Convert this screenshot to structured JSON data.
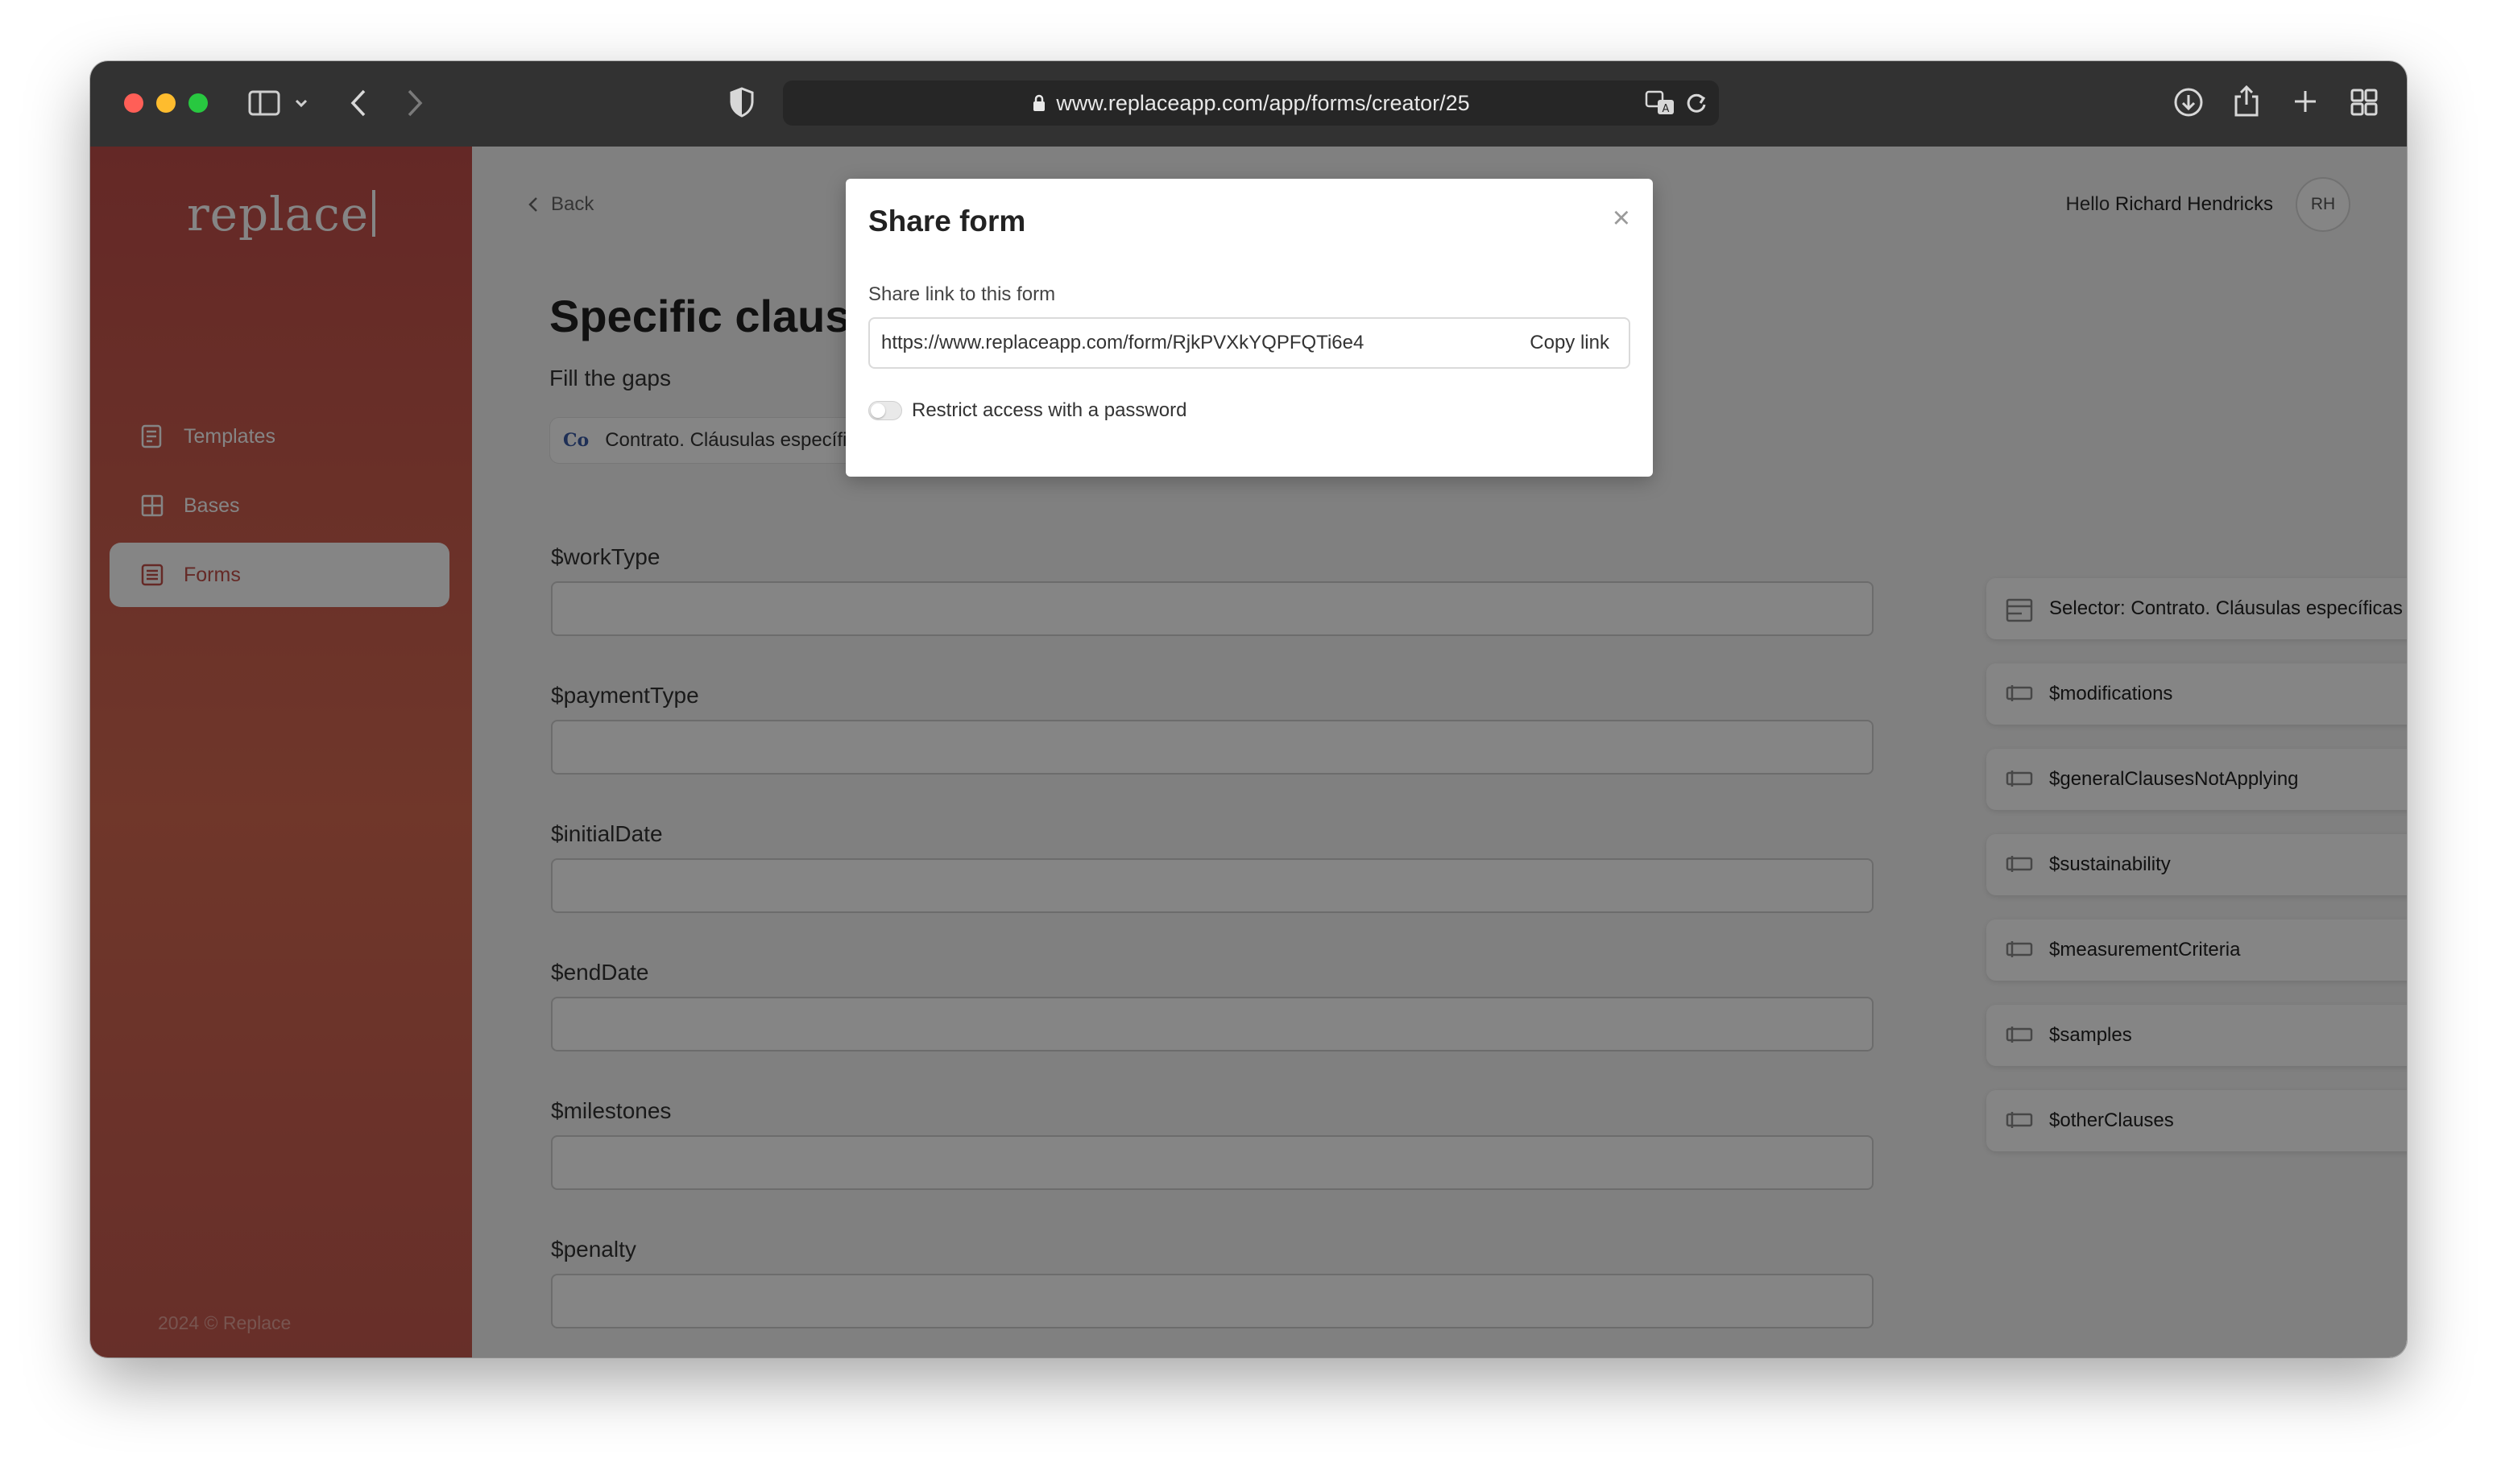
{
  "browser": {
    "url": "www.replaceapp.com/app/forms/creator/25",
    "icons": [
      "sidebar-toggle-icon",
      "chevron-down-icon",
      "back-arrow-icon",
      "forward-arrow-icon",
      "shield-icon",
      "lock-icon",
      "translate-icon",
      "reload-icon",
      "download-icon",
      "share-icon",
      "plus-icon",
      "tabs-grid-icon"
    ]
  },
  "sidebar": {
    "logo": "replace",
    "items": [
      {
        "label": "Templates",
        "icon": "templates-icon"
      },
      {
        "label": "Bases",
        "icon": "grid-icon"
      },
      {
        "label": "Forms",
        "icon": "form-icon",
        "active": true
      }
    ],
    "copyright": "2024 © Replace"
  },
  "header": {
    "back_label": "Back",
    "hello_prefix": "Hello",
    "user_name": "Richard Hendricks",
    "avatar_initials": "RH"
  },
  "page": {
    "title": "Specific clauses",
    "subtitle": "Fill the gaps",
    "chips": [
      {
        "badge": "Co",
        "label": "Contrato. Cláusulas específicas"
      },
      {
        "label": ""
      },
      {
        "label": ""
      }
    ],
    "fields": [
      {
        "label": "$workType",
        "value": ""
      },
      {
        "label": "$paymentType",
        "value": ""
      },
      {
        "label": "$initialDate",
        "value": ""
      },
      {
        "label": "$endDate",
        "value": ""
      },
      {
        "label": "$milestones",
        "value": ""
      },
      {
        "label": "$penalty",
        "value": ""
      }
    ]
  },
  "right_panel": {
    "selector": "Selector: Contrato. Cláusulas específicas",
    "items": [
      "$modifications",
      "$generalClausesNotApplying",
      "$sustainability",
      "$measurementCriteria",
      "$samples",
      "$otherClauses"
    ]
  },
  "modal": {
    "title": "Share form",
    "close_symbol": "×",
    "link_label": "Share link to this form",
    "link_value": "https://www.replaceapp.com/form/RjkPVXkYQPFQTi6e4",
    "copy_label": "Copy link",
    "restrict_label": "Restrict access with a password",
    "restrict_enabled": false
  },
  "colors": {
    "brand": "#c04e4a",
    "chrome": "#323232"
  }
}
